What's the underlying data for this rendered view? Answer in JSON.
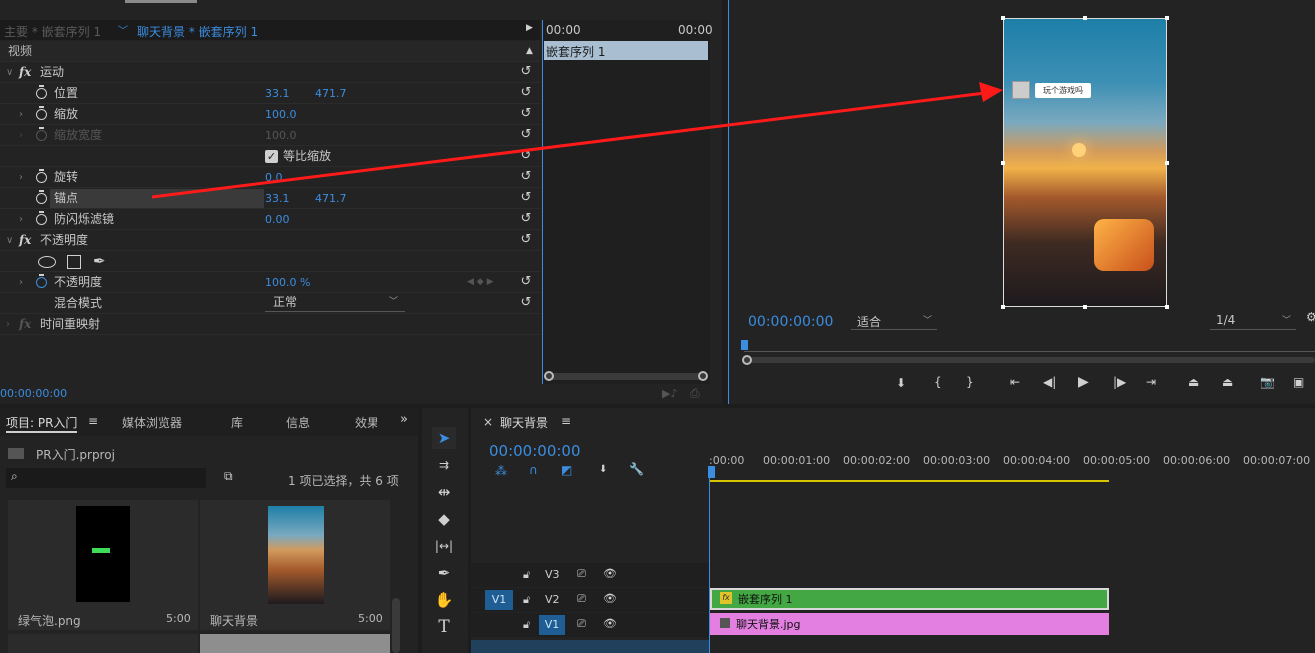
{
  "effect_controls": {
    "tab_master": "主要 * 嵌套序列 1",
    "tab_active": "聊天背景 * 嵌套序列 1",
    "mini_time_start": "00:00",
    "mini_time_end": "00:00",
    "mini_clip": "嵌套序列 1",
    "section_video": "视频",
    "fx_motion": "运动",
    "position_label": "位置",
    "position_x": "33.1",
    "position_y": "471.7",
    "scale_label": "缩放",
    "scale_value": "100.0",
    "scale_width_label": "缩放宽度",
    "scale_width_value": "100.0",
    "uniform_scale_label": "等比缩放",
    "rotation_label": "旋转",
    "rotation_value": "0.0",
    "anchor_label": "锚点",
    "anchor_x": "33.1",
    "anchor_y": "471.7",
    "antiflicker_label": "防闪烁滤镜",
    "antiflicker_value": "0.00",
    "fx_opacity": "不透明度",
    "opacity_label": "不透明度",
    "opacity_value": "100.0 %",
    "blend_label": "混合模式",
    "blend_value": "正常",
    "fx_time_remap": "时间重映射",
    "timecode": "00:00:00:00"
  },
  "program": {
    "bubble_text": "玩个游戏吗",
    "timecode": "00:00:00:00",
    "fit": "适合",
    "resolution": "1/4"
  },
  "project": {
    "tab_project": "项目: PR入门",
    "tab_media": "媒体浏览器",
    "tab_library": "库",
    "tab_info": "信息",
    "tab_effects": "效果",
    "file": "PR入门.prproj",
    "selection": "1 项已选择，共 6 项",
    "item1_name": "绿气泡.png",
    "item1_dur": "5:00",
    "item2_name": "聊天背景",
    "item2_dur": "5:00"
  },
  "timeline": {
    "tab": "聊天背景",
    "timecode": "00:00:00:00",
    "ruler": [
      ":00:00",
      "00:00:01:00",
      "00:00:02:00",
      "00:00:03:00",
      "00:00:04:00",
      "00:00:05:00",
      "00:00:06:00",
      "00:00:07:00"
    ],
    "v3": "V3",
    "v2": "V2",
    "v1": "V1",
    "src": "V1",
    "clip_v2": "嵌套序列 1",
    "clip_v1": "聊天背景.jpg"
  }
}
